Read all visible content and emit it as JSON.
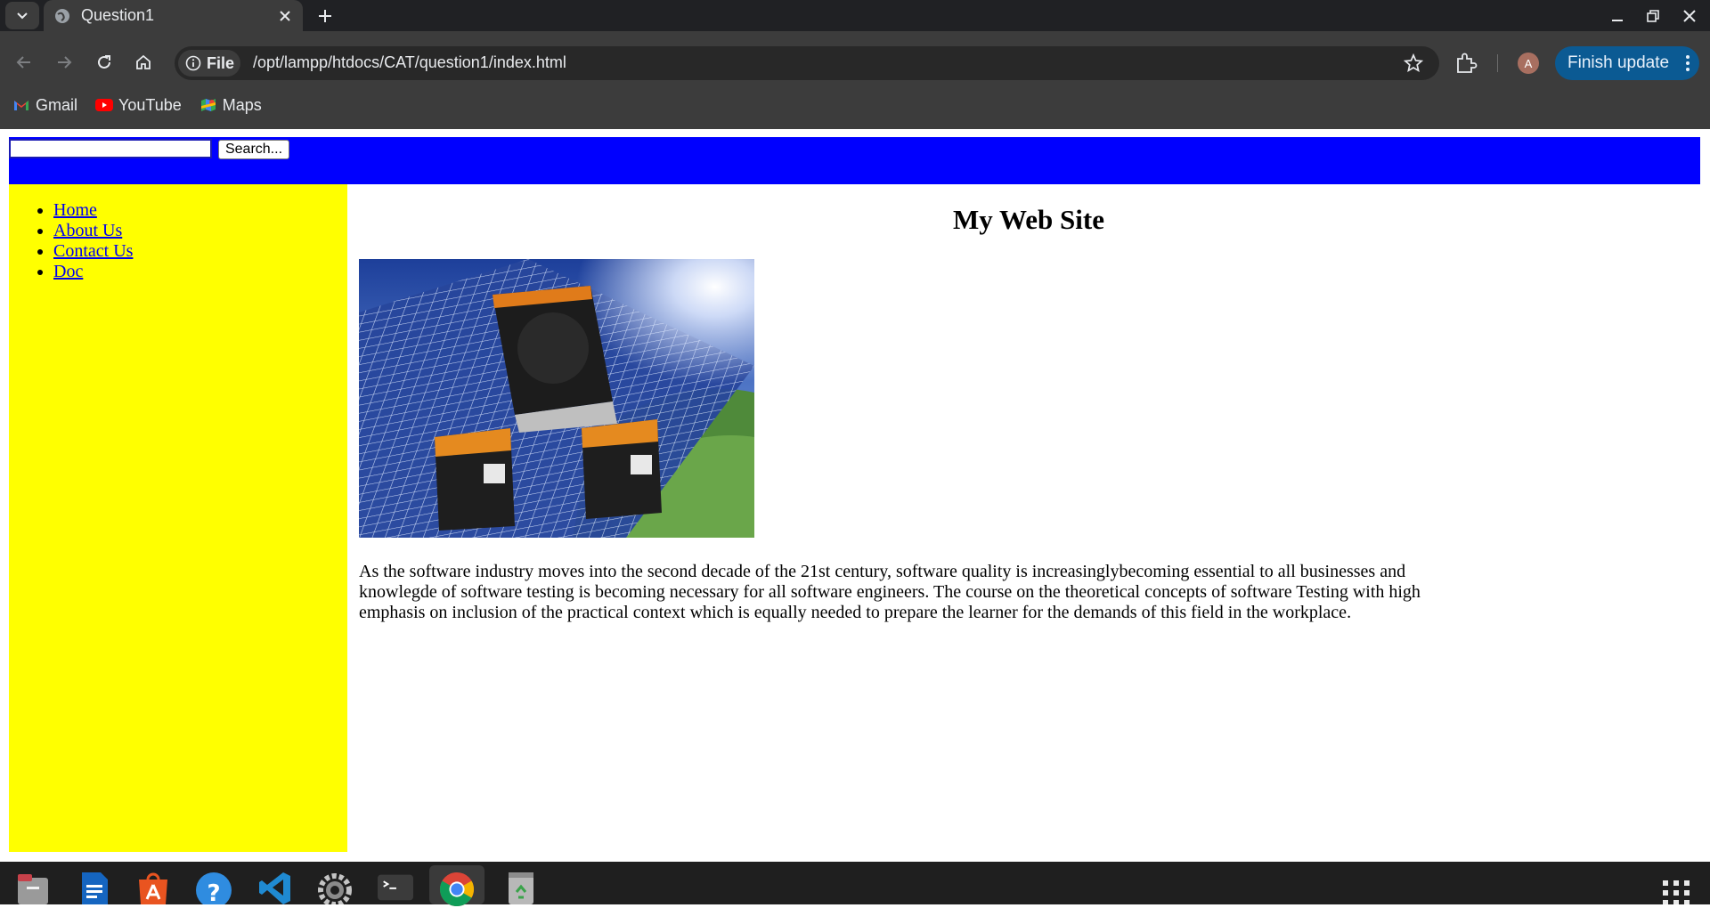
{
  "browser": {
    "tab_title": "Question1",
    "address": {
      "chip_label": "File",
      "url": "/opt/lampp/htdocs/CAT/question1/index.html"
    },
    "profile_initial": "A",
    "update_label": "Finish update",
    "bookmarks": [
      {
        "label": "Gmail",
        "icon": "gmail-icon"
      },
      {
        "label": "YouTube",
        "icon": "youtube-icon"
      },
      {
        "label": "Maps",
        "icon": "maps-icon"
      }
    ]
  },
  "page": {
    "search": {
      "value": "",
      "button_label": "Search..."
    },
    "nav": [
      "Home",
      "About Us",
      "Contact Us",
      "Doc"
    ],
    "title": "My Web Site",
    "body_text": "As the software industry moves into the second decade of the 21st century, software quality is increasinglybecoming essential to all businesses and knowlegde of software testing is becoming necessary for all software engineers. The course on the theoretical concepts of software Testing with high emphasis on inclusion of the practical context which is equally needed to prepare the learner for the demands of this field in the workplace.",
    "colors": {
      "header": "#0000ff",
      "sidebar": "#ffff00",
      "link": "#0000ee"
    }
  },
  "taskbar": {
    "apps": [
      "files-icon",
      "writer-icon",
      "app-center-icon",
      "help-icon",
      "vscode-icon",
      "settings-icon",
      "terminal-icon",
      "chrome-icon",
      "trash-icon"
    ],
    "active_app": "chrome-icon"
  }
}
